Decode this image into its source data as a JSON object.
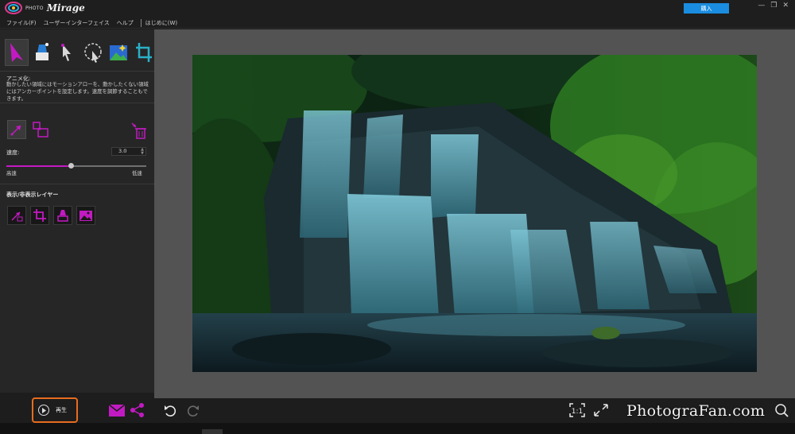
{
  "app": {
    "logo_small": "PHOTO",
    "logo_big": "Mirage",
    "buy_label": "購入",
    "window_controls": [
      "—",
      "❐",
      "✕"
    ],
    "accent_color": "#c21ac2",
    "highlight_color": "#e76c1f",
    "buy_color": "#1a8de0"
  },
  "menu": {
    "items": [
      "ファイル(F)",
      "ユーザーインターフェイス",
      "ヘルプ",
      "はじめに(W)"
    ]
  },
  "panel": {
    "tools": [
      "motion-arrow-icon",
      "eraser-icon",
      "select-arrow-icon",
      "lasso-icon",
      "image-icon",
      "crop-icon"
    ],
    "section_title": "アニメ化:",
    "description": "動かしたい領域にはモーションアローを、動かしたくない領域にはアンカーポイントを設定します。速度を調節することもできます。",
    "speed_label": "速度:",
    "speed_value": "3.0",
    "speed_fraction": 0.46,
    "slider_min_label": "高速",
    "slider_max_label": "低速",
    "layers_title": "表示/非表示レイヤー"
  },
  "bottom": {
    "play_label": "再生",
    "watermark": "PhotograFan.com"
  }
}
